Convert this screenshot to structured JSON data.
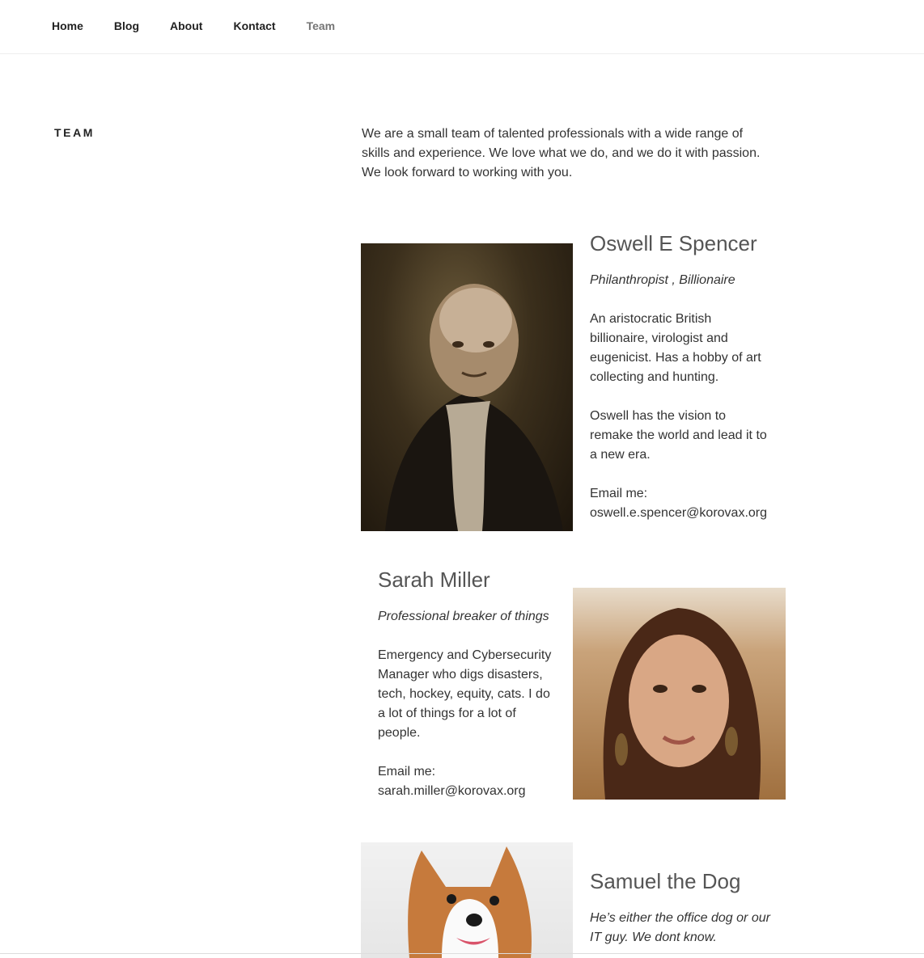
{
  "nav": {
    "items": [
      {
        "label": "Home"
      },
      {
        "label": "Blog"
      },
      {
        "label": "About"
      },
      {
        "label": "Kontact"
      },
      {
        "label": "Team"
      }
    ]
  },
  "page": {
    "title": "TEAM",
    "intro": "We are a small team of talented professionals with a wide range of skills and experience. We love what we do, and we do it with passion. We look forward to working with you."
  },
  "members": [
    {
      "name": "Oswell E Spencer",
      "role": "Philanthropist , Billionaire",
      "desc1": "An aristocratic British billionaire, virologist and eugenicist. Has a hobby of art collecting and hunting.",
      "desc2": "Oswell has the vision to remake the world and lead it to a new era.",
      "email_label": "Email me:",
      "email": "oswell.e.spencer@korovax.org"
    },
    {
      "name": "Sarah Miller",
      "role": "Professional breaker of things",
      "desc1": "Emergency and Cybersecurity Manager who digs disasters, tech, hockey, equity, cats. I do a lot of things for a lot of people.",
      "email_label": "Email me:",
      "email": "sarah.miller@korovax.org"
    },
    {
      "name": "Samuel the Dog",
      "role": "He’s either the office dog or our IT guy. We dont know."
    }
  ]
}
